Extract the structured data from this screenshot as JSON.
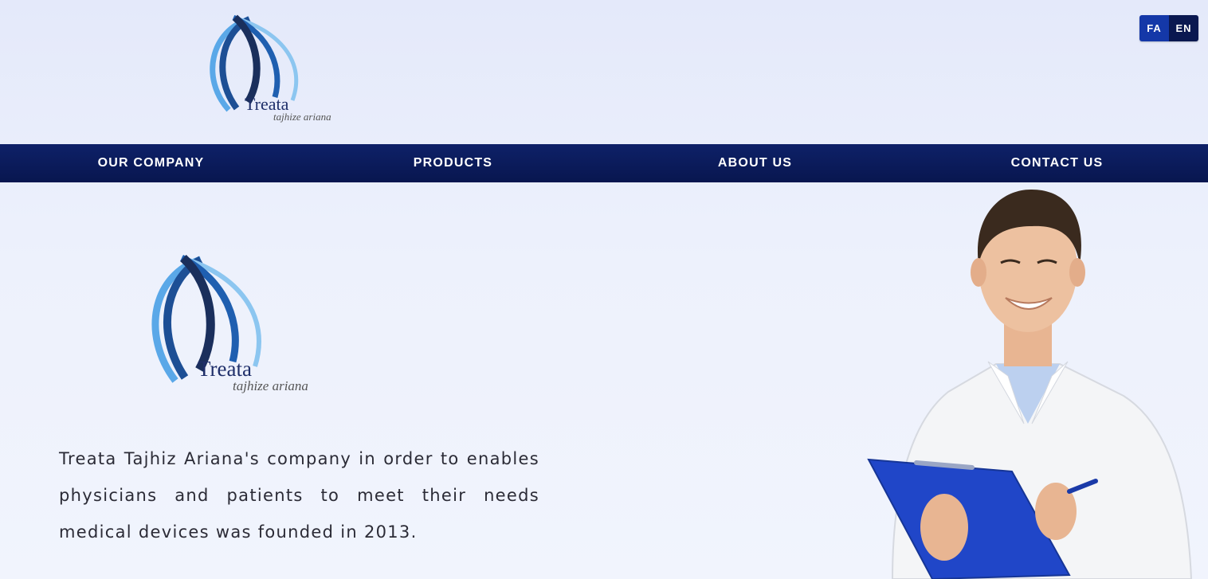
{
  "header": {
    "logo": {
      "brand": "Treata",
      "tagline": "tajhize ariana"
    },
    "language": {
      "fa_label": "FA",
      "en_label": "EN"
    }
  },
  "nav": {
    "items": [
      {
        "label": "OUR COMPANY"
      },
      {
        "label": "PRODUCTS"
      },
      {
        "label": "ABOUT US"
      },
      {
        "label": "CONTACT US"
      }
    ]
  },
  "main": {
    "logo": {
      "brand": "Treata",
      "tagline": "tajhize ariana"
    },
    "intro_text": "Treata Tajhiz Ariana's company in order to enables physicians and patients to meet their needs medical devices was founded in 2013."
  },
  "colors": {
    "nav_bg": "#0a1850",
    "lang_fa": "#1438a8",
    "lang_en": "#0a1850",
    "logo_dark": "#1d3f74",
    "logo_light": "#5aa8e8"
  }
}
